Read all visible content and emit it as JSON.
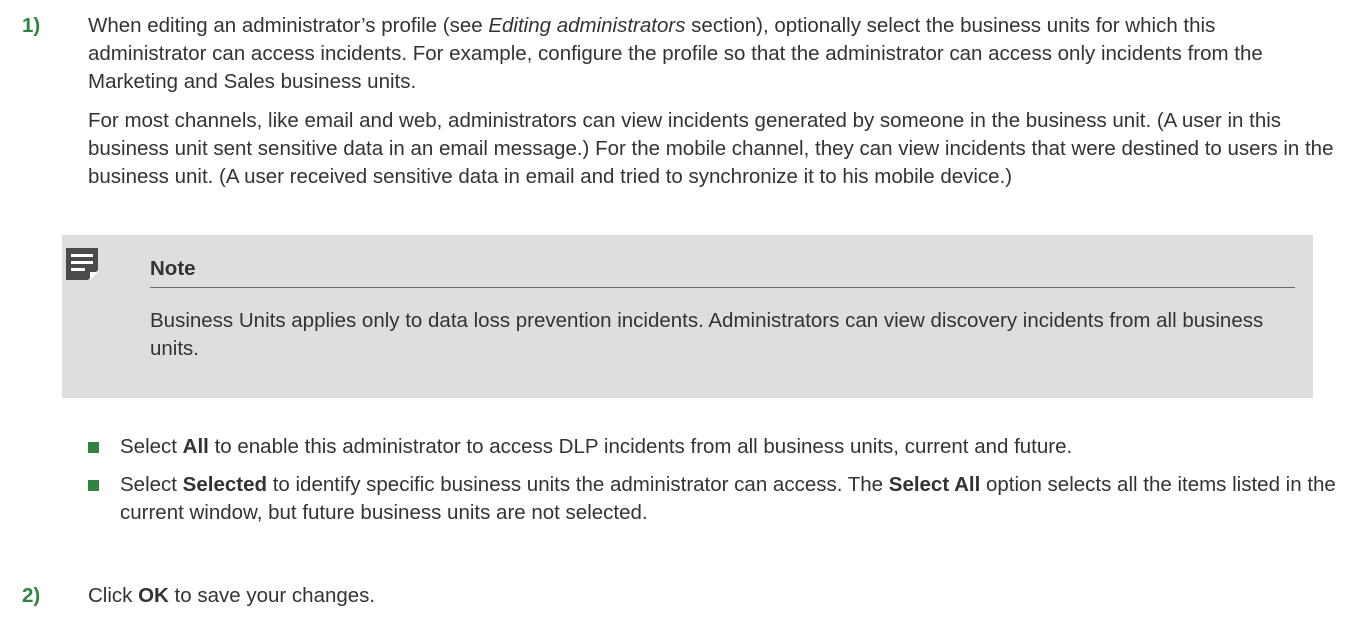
{
  "step1": {
    "number": "1)",
    "intro": [
      {
        "text": "When editing an administrator’s profile (see "
      },
      {
        "text": "Editing administrators",
        "style": "italic"
      },
      {
        "text": " section), optionally select the business units for which this administrator can access incidents. For example, configure the profile so that the administrator can access only incidents from the Marketing and Sales business units."
      }
    ],
    "detail": "For most channels, like email and web, administrators can view incidents generated by someone in the business unit. (A user in this business unit sent sensitive data in an email message.) For the mobile channel, they can view incidents that were destined to users in the business unit. (A user received sensitive data in email and tried to synchronize it to his mobile device.)"
  },
  "note": {
    "icon": "note-icon",
    "title": "Note",
    "text": "Business Units applies only to data loss prevention incidents. Administrators can view discovery incidents from all business units."
  },
  "bullets": [
    [
      {
        "text": "Select "
      },
      {
        "text": "All",
        "style": "bold"
      },
      {
        "text": " to enable this administrator to access DLP incidents from all business units, current and future."
      }
    ],
    [
      {
        "text": "Select "
      },
      {
        "text": "Selected",
        "style": "bold"
      },
      {
        "text": " to identify specific business units the administrator can access. The "
      },
      {
        "text": "Select All",
        "style": "bold"
      },
      {
        "text": " option selects all the items listed in the current window, but future business units are not selected."
      }
    ]
  ],
  "step2": {
    "number": "2)",
    "content": [
      {
        "text": "Click "
      },
      {
        "text": "OK",
        "style": "bold"
      },
      {
        "text": " to save your changes."
      }
    ]
  },
  "colors": {
    "accent": "#2e8540",
    "text": "#333333",
    "note_background": "#dedede",
    "icon": "#4a4a4a"
  }
}
